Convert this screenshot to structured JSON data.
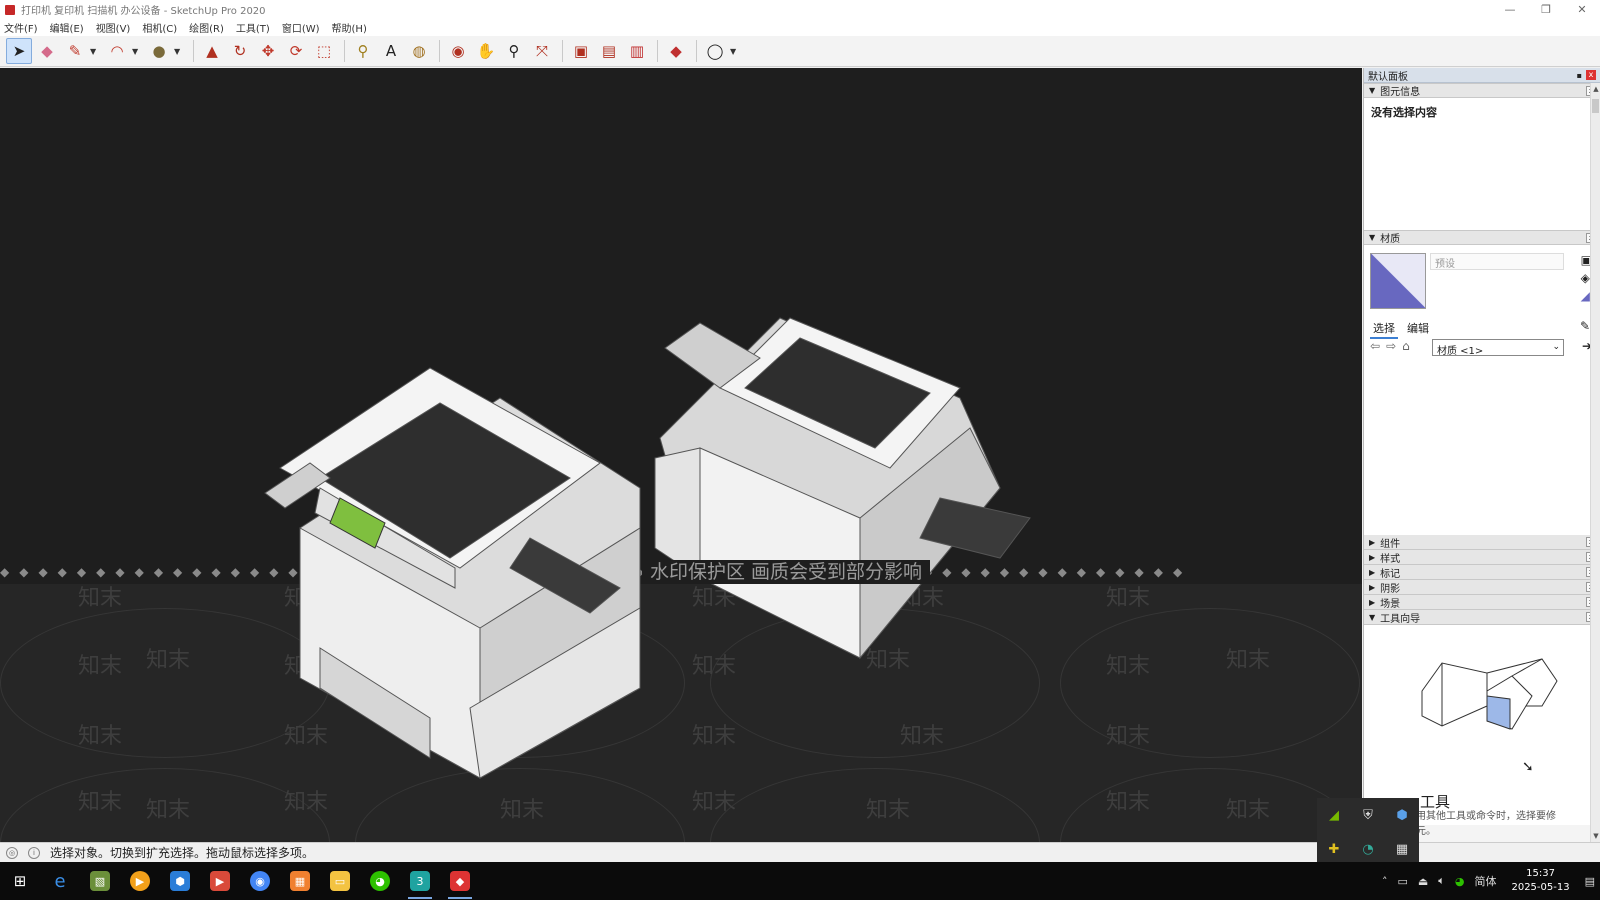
{
  "window": {
    "title": "打印机 复印机 扫描机 办公设备 - SketchUp Pro 2020"
  },
  "menu": [
    "文件(F)",
    "编辑(E)",
    "视图(V)",
    "相机(C)",
    "绘图(R)",
    "工具(T)",
    "窗口(W)",
    "帮助(H)"
  ],
  "toolbar_icons": [
    "select-icon",
    "eraser-icon",
    "pencil-icon",
    "arc-icon",
    "shape-icon",
    "push-pull-icon",
    "follow-me-icon",
    "move-icon",
    "rotate-icon",
    "scale-icon",
    "tape-measure-icon",
    "text-icon",
    "paint-bucket-icon",
    "orbit-icon",
    "pan-icon",
    "zoom-icon",
    "zoom-extents-icon",
    "warehouse-icon",
    "extension-warehouse-icon",
    "layout-icon",
    "ruby-icon",
    "account-icon"
  ],
  "viewport": {
    "watermark_text": "水印保护区  画质会受到部分影响",
    "watermark_mark": "知末"
  },
  "panel": {
    "title": "默认面板",
    "entity_info": {
      "title": "图元信息",
      "content": "没有选择内容"
    },
    "materials": {
      "title": "材质",
      "name_placeholder": "预设",
      "tab_select": "选择",
      "tab_edit": "编辑",
      "dropdown_value": "材质 <1>"
    },
    "collapsed_sections": [
      "组件",
      "样式",
      "标记",
      "阴影",
      "场景"
    ],
    "instructor": {
      "title": "工具向导",
      "heading": "工具",
      "desc": "用其他工具或命令时，选择要修\n元。"
    }
  },
  "status": {
    "message": "选择对象。切换到扩充选择。拖动鼠标选择多项。"
  },
  "taskbar": {
    "time": "15:37",
    "date": "2025-05-13",
    "ime": "简体"
  },
  "colors": {
    "viewport_bg": "#1e1e1e",
    "panel_header": "#d8e0ea",
    "accent": "#3c7fd3"
  }
}
